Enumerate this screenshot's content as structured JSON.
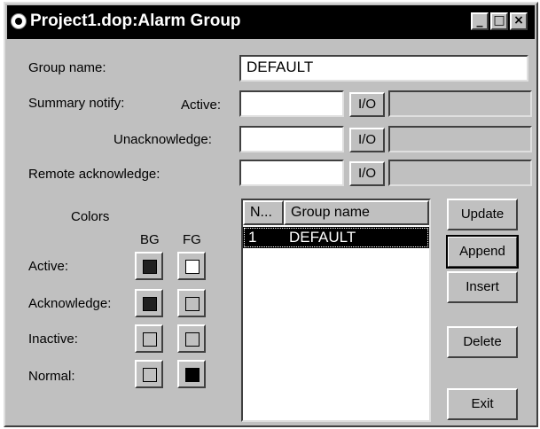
{
  "window": {
    "title": "Project1.dop:Alarm Group",
    "minimize": "_",
    "maximize": "□",
    "close": "×"
  },
  "form": {
    "group_name_label": "Group name:",
    "group_name_value": "DEFAULT",
    "summary_notify_label": "Summary notify:",
    "active_label": "Active:",
    "unacknowledge_label": "Unacknowledge:",
    "remote_ack_label": "Remote acknowledge:",
    "io_label": "I/O"
  },
  "colors": {
    "title": "Colors",
    "bg_header": "BG",
    "fg_header": "FG",
    "rows": [
      {
        "label": "Active:",
        "bg": "#202020",
        "fg": "#ffffff"
      },
      {
        "label": "Acknowledge:",
        "bg": "#202020",
        "fg": "#c0c0c0"
      },
      {
        "label": "Inactive:",
        "bg": "#c0c0c0",
        "fg": "#c0c0c0"
      },
      {
        "label": "Normal:",
        "bg": "#c0c0c0",
        "fg": "#000000"
      }
    ]
  },
  "list": {
    "columns": [
      "N...",
      "Group name"
    ],
    "rows": [
      {
        "n": "1",
        "name": "DEFAULT"
      }
    ]
  },
  "buttons": {
    "update": "Update",
    "append": "Append",
    "insert": "Insert",
    "delete": "Delete",
    "exit": "Exit"
  }
}
